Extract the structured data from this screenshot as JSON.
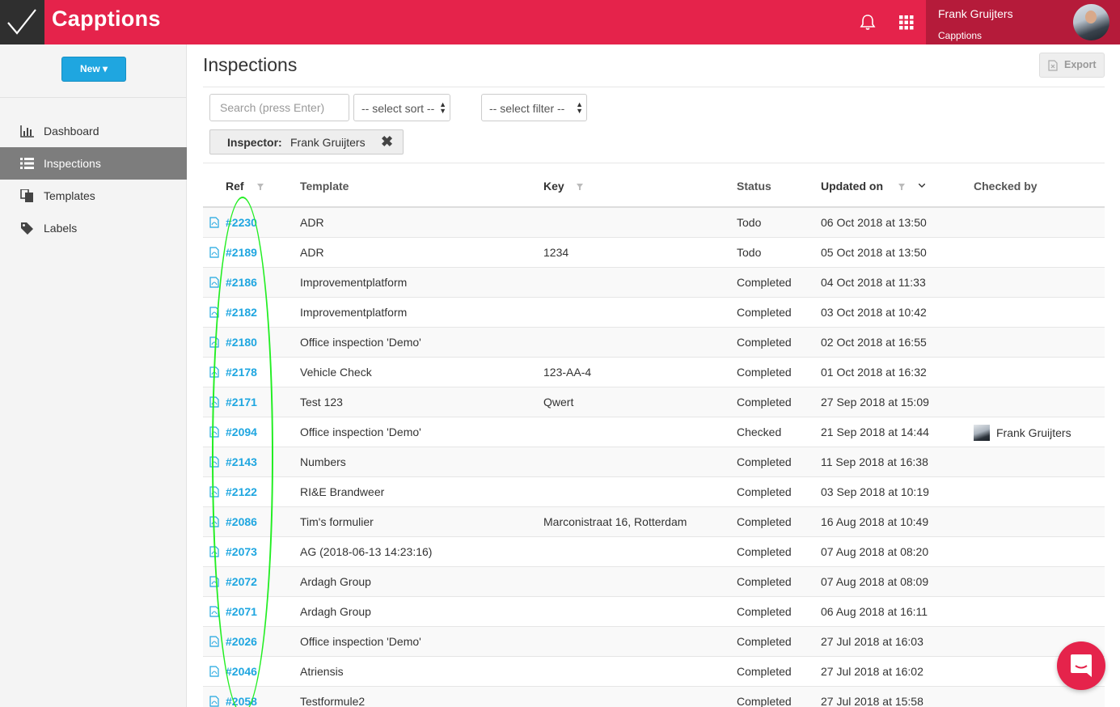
{
  "header": {
    "brand": "Capptions",
    "user_name": "Frank Gruijters",
    "user_org": "Capptions",
    "accent": "#e5234b"
  },
  "sidebar": {
    "new_label": "New ▾",
    "items": [
      {
        "label": "Dashboard",
        "icon": "bar-chart-icon"
      },
      {
        "label": "Inspections",
        "icon": "list-icon",
        "active": true
      },
      {
        "label": "Templates",
        "icon": "copy-icon"
      },
      {
        "label": "Labels",
        "icon": "tags-icon"
      }
    ]
  },
  "main": {
    "title": "Inspections",
    "export_label": "Export",
    "search_placeholder": "Search (press Enter)",
    "sort_label": "-- select sort --",
    "filter_label": "-- select filter --",
    "chip_key": "Inspector:",
    "chip_value": "Frank Gruijters"
  },
  "table": {
    "columns": [
      "Ref",
      "Template",
      "Key",
      "Status",
      "Updated on",
      "Checked by"
    ],
    "rows": [
      {
        "ref": "#2230",
        "template": "ADR",
        "key": "",
        "status": "Todo",
        "updated": "06 Oct 2018 at 13:50",
        "checked_by": ""
      },
      {
        "ref": "#2189",
        "template": "ADR",
        "key": "1234",
        "status": "Todo",
        "updated": "05 Oct 2018 at 13:50",
        "checked_by": ""
      },
      {
        "ref": "#2186",
        "template": "Improvementplatform",
        "key": "",
        "status": "Completed",
        "updated": "04 Oct 2018 at 11:33",
        "checked_by": ""
      },
      {
        "ref": "#2182",
        "template": "Improvementplatform",
        "key": "",
        "status": "Completed",
        "updated": "03 Oct 2018 at 10:42",
        "checked_by": ""
      },
      {
        "ref": "#2180",
        "template": "Office inspection 'Demo'",
        "key": "",
        "status": "Completed",
        "updated": "02 Oct 2018 at 16:55",
        "checked_by": ""
      },
      {
        "ref": "#2178",
        "template": "Vehicle Check",
        "key": "123-AA-4",
        "status": "Completed",
        "updated": "01 Oct 2018 at 16:32",
        "checked_by": ""
      },
      {
        "ref": "#2171",
        "template": "Test 123",
        "key": "Qwert",
        "status": "Completed",
        "updated": "27 Sep 2018 at 15:09",
        "checked_by": ""
      },
      {
        "ref": "#2094",
        "template": "Office inspection 'Demo'",
        "key": "",
        "status": "Checked",
        "updated": "21 Sep 2018 at 14:44",
        "checked_by": "Frank Gruijters"
      },
      {
        "ref": "#2143",
        "template": "Numbers",
        "key": "",
        "status": "Completed",
        "updated": "11 Sep 2018 at 16:38",
        "checked_by": ""
      },
      {
        "ref": "#2122",
        "template": "RI&E Brandweer",
        "key": "",
        "status": "Completed",
        "updated": "03 Sep 2018 at 10:19",
        "checked_by": ""
      },
      {
        "ref": "#2086",
        "template": "Tim's formulier",
        "key": "Marconistraat 16, Rotterdam",
        "status": "Completed",
        "updated": "16 Aug 2018 at 10:49",
        "checked_by": ""
      },
      {
        "ref": "#2073",
        "template": "AG (2018-06-13 14:23:16)",
        "key": "",
        "status": "Completed",
        "updated": "07 Aug 2018 at 08:20",
        "checked_by": ""
      },
      {
        "ref": "#2072",
        "template": "Ardagh Group",
        "key": "",
        "status": "Completed",
        "updated": "07 Aug 2018 at 08:09",
        "checked_by": ""
      },
      {
        "ref": "#2071",
        "template": "Ardagh Group",
        "key": "",
        "status": "Completed",
        "updated": "06 Aug 2018 at 16:11",
        "checked_by": ""
      },
      {
        "ref": "#2026",
        "template": "Office inspection 'Demo'",
        "key": "",
        "status": "Completed",
        "updated": "27 Jul 2018 at 16:03",
        "checked_by": ""
      },
      {
        "ref": "#2046",
        "template": "Atriensis",
        "key": "",
        "status": "Completed",
        "updated": "27 Jul 2018 at 16:02",
        "checked_by": ""
      },
      {
        "ref": "#2058",
        "template": "Testformule2",
        "key": "",
        "status": "Completed",
        "updated": "27 Jul 2018 at 15:58",
        "checked_by": ""
      }
    ]
  }
}
